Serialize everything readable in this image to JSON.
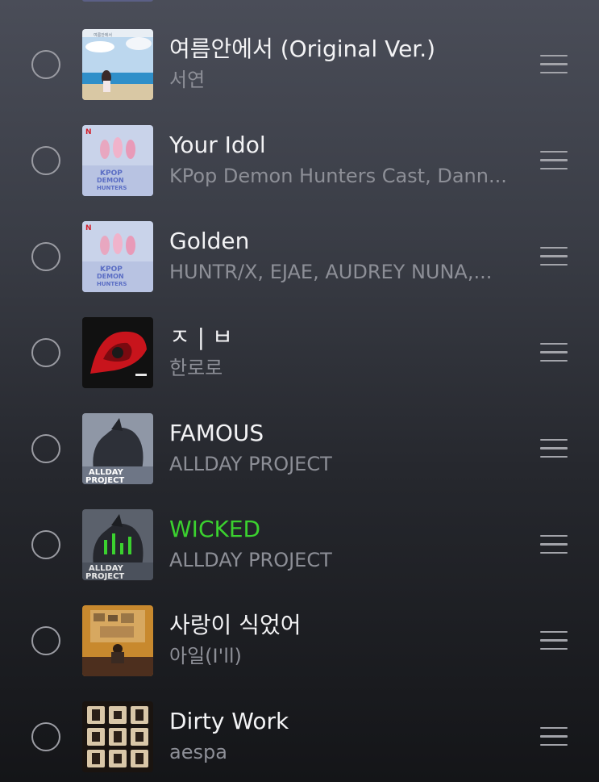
{
  "playlist": {
    "tracks": [
      {
        "title": "여름안에서 (Original Ver.)",
        "artist": "서연",
        "cover": "summer-beach-cover",
        "playing": false
      },
      {
        "title": "Your Idol",
        "artist": "KPop Demon Hunters Cast, Dann...",
        "cover": "kpop-demon-hunters-cover",
        "playing": false
      },
      {
        "title": "Golden",
        "artist": "HUNTR/X, EJAE, AUDREY NUNA,...",
        "cover": "kpop-demon-hunters-cover",
        "playing": false
      },
      {
        "title": "ㅈ | ㅂ",
        "artist": "한로로",
        "cover": "red-abstract-cover",
        "playing": false
      },
      {
        "title": "FAMOUS",
        "artist": "ALLDAY PROJECT",
        "cover": "allday-project-cover",
        "playing": false
      },
      {
        "title": "WICKED",
        "artist": "ALLDAY PROJECT",
        "cover": "allday-project-wicked-cover",
        "playing": true
      },
      {
        "title": "사랑이 식었어",
        "artist": "아일(I'll)",
        "cover": "room-photo-cover",
        "playing": false
      },
      {
        "title": "Dirty Work",
        "artist": "aespa",
        "cover": "aespa-dirty-work-cover",
        "playing": false
      }
    ]
  },
  "colors": {
    "playing_title": "#3bd12f",
    "title": "#f3f3f5",
    "artist": "#8d8f97"
  },
  "icons": {
    "select": "circle-outline-icon",
    "reorder": "drag-handle-icon",
    "equalizer": "playing-equalizer-icon"
  }
}
